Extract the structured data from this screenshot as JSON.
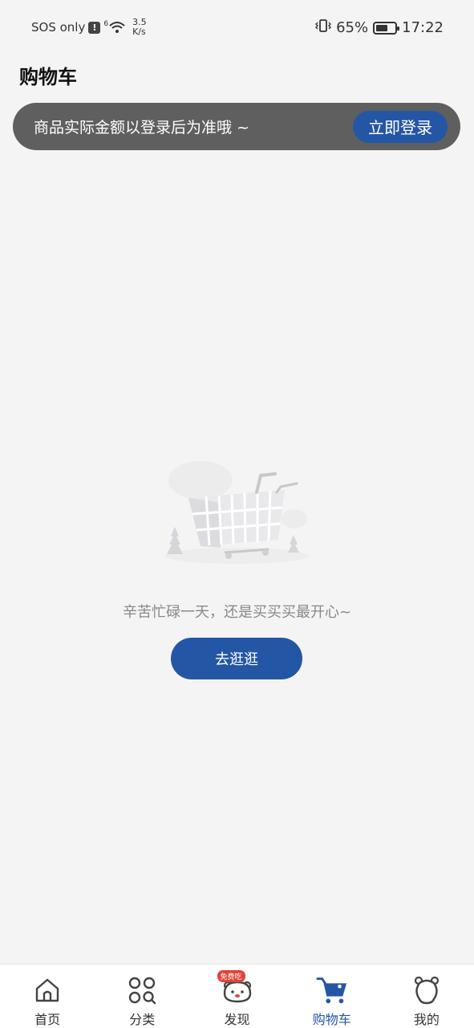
{
  "status_bar": {
    "carrier": "SOS only",
    "alert": "!",
    "network_gen": "6",
    "speed_value": "3.5",
    "speed_unit": "K/s",
    "battery": "65%",
    "battery_level": 0.65,
    "time": "17:22"
  },
  "header": {
    "title": "购物车"
  },
  "login_banner": {
    "text": "商品实际金额以登录后为准哦 ~",
    "button_label": "立即登录"
  },
  "empty_state": {
    "message": "辛苦忙碌一天，还是买买买最开心~",
    "button_label": "去逛逛"
  },
  "bottom_nav": {
    "items": [
      {
        "label": "首页",
        "icon": "home-icon"
      },
      {
        "label": "分类",
        "icon": "category-icon"
      },
      {
        "label": "发现",
        "icon": "discover-icon",
        "badge": "免费吃"
      },
      {
        "label": "购物车",
        "icon": "cart-icon",
        "active": true
      },
      {
        "label": "我的",
        "icon": "profile-icon"
      }
    ]
  },
  "colors": {
    "accent": "#2456a6",
    "banner_bg": "#5f5f5f",
    "page_bg": "#f4f4f4",
    "badge": "#e0443a"
  }
}
